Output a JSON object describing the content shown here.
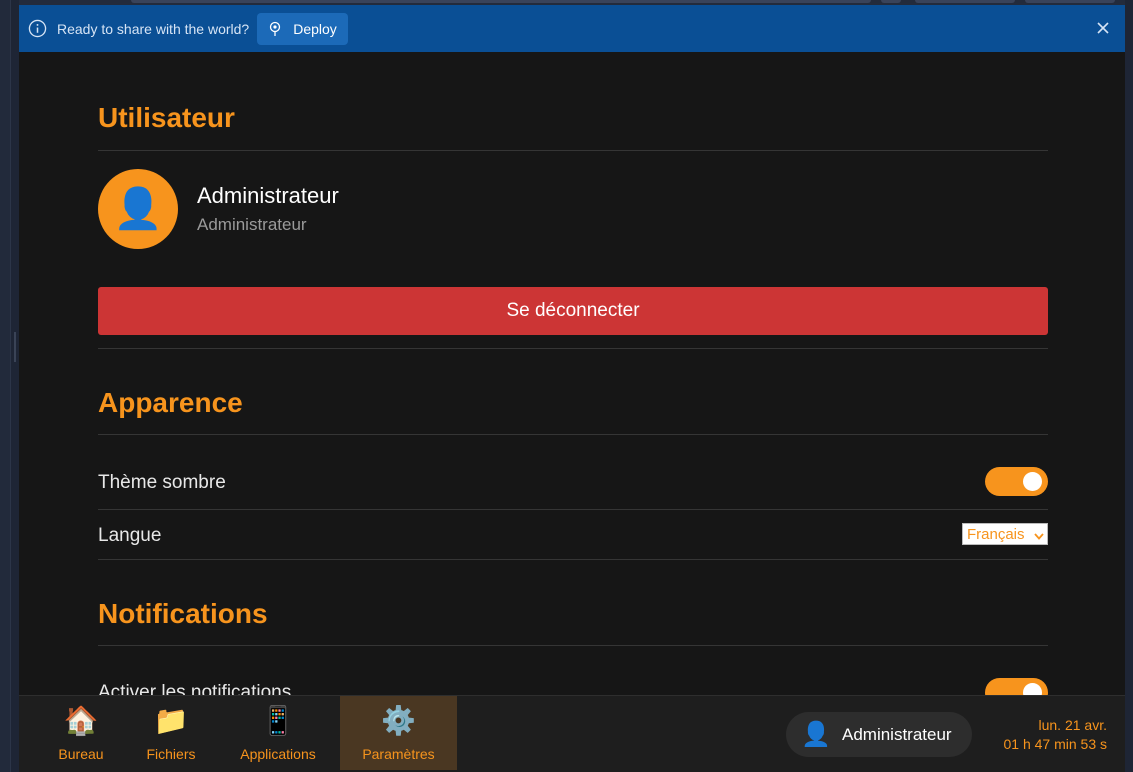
{
  "banner": {
    "message": "Ready to share with the world?",
    "deploy_label": "Deploy",
    "icons": {
      "info": "info-icon",
      "deploy": "deploy-icon",
      "close": "close-icon"
    },
    "background": "#0a4f95"
  },
  "sections": {
    "user": {
      "title": "Utilisateur",
      "name": "Administrateur",
      "role": "Administrateur",
      "avatar_icon": "👤",
      "logout_label": "Se déconnecter"
    },
    "appearance": {
      "title": "Apparence",
      "dark_theme_label": "Thème sombre",
      "dark_theme_on": true,
      "language_label": "Langue",
      "language_value": "Français"
    },
    "notifications": {
      "title": "Notifications",
      "enable_label": "Activer les notifications",
      "enable_on": true
    }
  },
  "taskbar": {
    "items": [
      {
        "icon": "🏠",
        "label": "Bureau",
        "active": false
      },
      {
        "icon": "📁",
        "label": "Fichiers",
        "active": false
      },
      {
        "icon": "📱",
        "label": "Applications",
        "active": false
      },
      {
        "icon": "⚙️",
        "label": "Paramètres",
        "active": true
      }
    ],
    "user_icon": "👤",
    "user_name": "Administrateur",
    "date": "lun. 21 avr.",
    "time": "01 h 47 min 53 s"
  },
  "colors": {
    "accent": "#f7941d",
    "danger": "#cc3535",
    "background": "#161616"
  }
}
